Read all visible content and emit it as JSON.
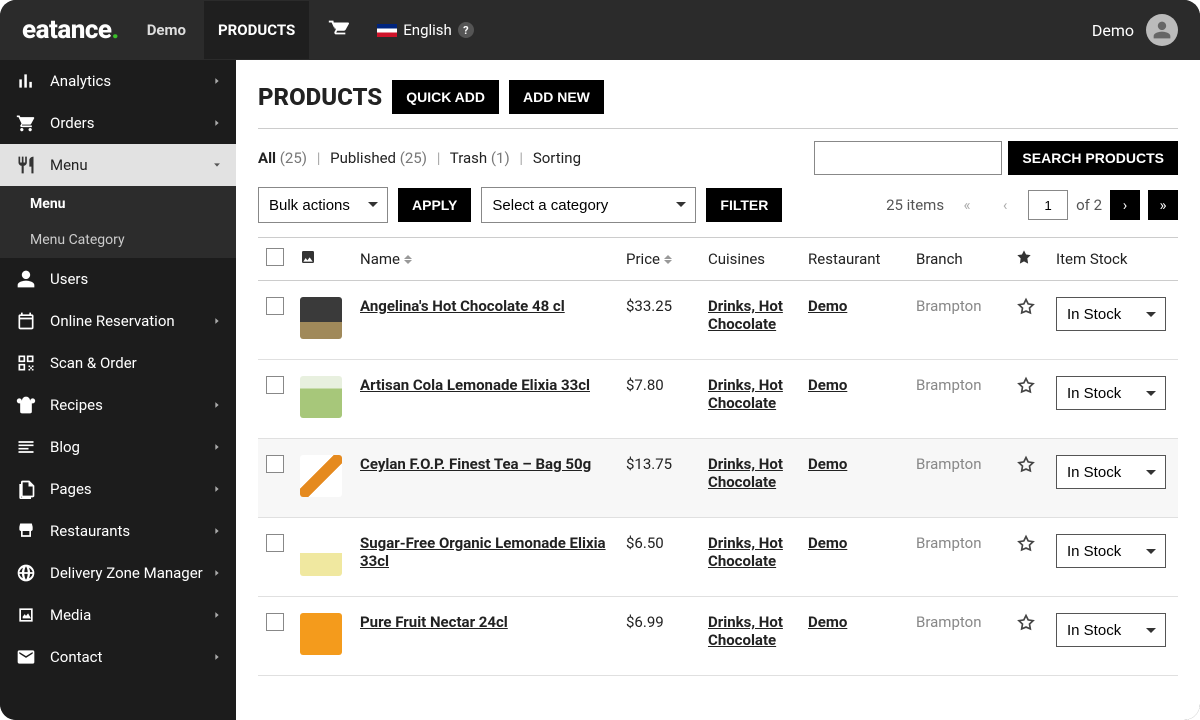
{
  "brand": {
    "name": "eatance",
    "dot": "."
  },
  "topnav": {
    "demo": "Demo",
    "products": "PRODUCTS",
    "language": "English"
  },
  "user": {
    "name": "Demo"
  },
  "sidebar": {
    "items": [
      {
        "label": "Analytics",
        "icon": "analytics-icon",
        "arrow": true
      },
      {
        "label": "Orders",
        "icon": "cart-icon",
        "arrow": true
      },
      {
        "label": "Menu",
        "icon": "menu-icon",
        "arrow": true,
        "active": true
      },
      {
        "label": "Users",
        "icon": "users-icon",
        "arrow": false
      },
      {
        "label": "Online Reservation",
        "icon": "calendar-icon",
        "arrow": true
      },
      {
        "label": "Scan & Order",
        "icon": "qr-icon",
        "arrow": false
      },
      {
        "label": "Recipes",
        "icon": "recipes-icon",
        "arrow": true
      },
      {
        "label": "Blog",
        "icon": "blog-icon",
        "arrow": true
      },
      {
        "label": "Pages",
        "icon": "pages-icon",
        "arrow": true
      },
      {
        "label": "Restaurants",
        "icon": "store-icon",
        "arrow": true
      },
      {
        "label": "Delivery Zone Manager",
        "icon": "globe-icon",
        "arrow": true
      },
      {
        "label": "Media",
        "icon": "media-icon",
        "arrow": true
      },
      {
        "label": "Contact",
        "icon": "mail-icon",
        "arrow": true
      }
    ],
    "submenu": [
      {
        "label": "Menu",
        "selected": true
      },
      {
        "label": "Menu Category",
        "selected": false
      }
    ]
  },
  "page": {
    "title": "PRODUCTS",
    "quick_add": "QUICK ADD",
    "add_new": "ADD NEW"
  },
  "views": {
    "all_label": "All",
    "all_count": "(25)",
    "published_label": "Published",
    "published_count": "(25)",
    "trash_label": "Trash",
    "trash_count": "(1)",
    "sorting_label": "Sorting"
  },
  "search": {
    "button": "SEARCH PRODUCTS"
  },
  "bulk": {
    "bulk_actions": "Bulk actions",
    "apply": "APPLY",
    "category": "Select a category",
    "filter": "FILTER"
  },
  "pager": {
    "items_label": "25 items",
    "current": "1",
    "of": "of 2"
  },
  "table": {
    "headers": {
      "name": "Name",
      "price": "Price",
      "cuisines": "Cuisines",
      "restaurant": "Restaurant",
      "branch": "Branch",
      "stock": "Item Stock"
    },
    "stock_option": "In Stock",
    "rows": [
      {
        "name": "Angelina's Hot Chocolate 48 cl",
        "price": "$33.25",
        "cuisines": "Drinks, Hot Chocolate",
        "restaurant": "Demo",
        "branch": "Brampton",
        "thumbClass": "th1"
      },
      {
        "name": "Artisan Cola Lemonade Elixia 33cl",
        "price": "$7.80",
        "cuisines": "Drinks, Hot Chocolate",
        "restaurant": "Demo",
        "branch": "Brampton",
        "thumbClass": "th2"
      },
      {
        "name": "Ceylan F.O.P. Finest Tea – Bag 50g",
        "price": "$13.75",
        "cuisines": "Drinks, Hot Chocolate",
        "restaurant": "Demo",
        "branch": "Brampton",
        "thumbClass": "th3"
      },
      {
        "name": "Sugar-Free Organic Lemonade Elixia 33cl",
        "price": "$6.50",
        "cuisines": "Drinks, Hot Chocolate",
        "restaurant": "Demo",
        "branch": "Brampton",
        "thumbClass": "th4"
      },
      {
        "name": "Pure Fruit Nectar 24cl",
        "price": "$6.99",
        "cuisines": "Drinks, Hot Chocolate",
        "restaurant": "Demo",
        "branch": "Brampton",
        "thumbClass": "th5"
      }
    ]
  }
}
